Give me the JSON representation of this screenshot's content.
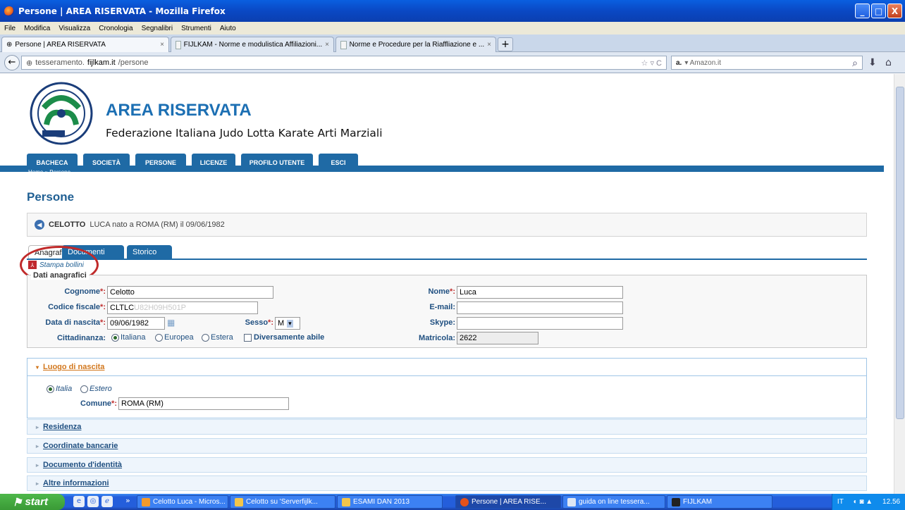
{
  "window": {
    "title": "Persone | AREA RISERVATA - Mozilla Firefox",
    "minimize": "_",
    "maximize": "□",
    "close": "X"
  },
  "menu": [
    "File",
    "Modifica",
    "Visualizza",
    "Cronologia",
    "Segnalibri",
    "Strumenti",
    "Aiuto"
  ],
  "tabs": [
    {
      "label": "Persone | AREA RISERVATA",
      "close": "×",
      "active": true
    },
    {
      "label": "FIJLKAM - Norme e modulistica Affiliazioni...",
      "close": "×"
    },
    {
      "label": "Norme e Procedure per la Riaffliazione e ...",
      "close": "×"
    }
  ],
  "newtab": "+",
  "nav": {
    "back": "←",
    "url_prefix": "tesseramento.",
    "url_host": "fijlkam.it",
    "url_path": "/persone",
    "star": "☆ ▿ C",
    "search_engine": "a.",
    "search_placeholder": "▾ Amazon.it",
    "search_icon": "⌕",
    "download_icon": "⬇",
    "home_icon": "⌂"
  },
  "site": {
    "title": "AREA RISERVATA",
    "subtitle": "Federazione Italiana Judo Lotta Karate Arti Marziali"
  },
  "main_nav": [
    "BACHECA",
    "SOCIETÀ",
    "PERSONE",
    "LICENZE",
    "PROFILO UTENTE",
    "ESCI"
  ],
  "breadcrumb": "Home » Persone",
  "page_title": "Persone",
  "person": {
    "icon": "◀",
    "surname": "CELOTTO",
    "rest": "LUCA nato a ROMA (RM) il 09/06/1982"
  },
  "person_tabs": [
    "Anagrafica",
    "Documenti",
    "Storico"
  ],
  "stampa": {
    "icon": "⅄",
    "label": "Stampa bollini"
  },
  "anagrafici": {
    "legend": "Dati anagrafici",
    "req_mark": "*:",
    "cognome_label": "Cognome",
    "cognome_value": "Celotto",
    "codice_label": "Codice fiscale",
    "codice_value": "CLTLC",
    "codice_ghost": "U82H09H501P",
    "nascita_label": "Data di nascita",
    "nascita_value": "09/06/1982",
    "cal_icon": "▦",
    "sesso_label": "Sesso",
    "sesso_value": "M",
    "sesso_arrow": "▾",
    "citt_label": "Cittadinanza:",
    "opt_italiana": "Italiana",
    "opt_europea": "Europea",
    "opt_estera": "Estera",
    "diversamente": "Diversamente abile",
    "nome_label": "Nome",
    "nome_value": "Luca",
    "email_label": "E-mail:",
    "email_value": "",
    "skype_label": "Skype:",
    "skype_value": "",
    "matricola_label": "Matricola:",
    "matricola_value": "2622"
  },
  "luogo": {
    "title": "Luogo di nascita",
    "arrow": "▾",
    "opt_italia": "Italia",
    "opt_estero": "Estero",
    "comune_label": "Comune",
    "comune_value": "ROMA (RM)"
  },
  "sections": [
    {
      "title": "Residenza",
      "arrow": "▸"
    },
    {
      "title": "Coordinate bancarie",
      "arrow": "▸"
    },
    {
      "title": "Documento d'identità",
      "arrow": "▸"
    },
    {
      "title": "Altre informazioni",
      "arrow": "▸"
    }
  ],
  "taskbar": {
    "start": "start",
    "items": [
      "Celotto Luca - Micros...",
      "Celotto su 'Serverfijlk...",
      "ESAMI DAN 2013",
      "Persone | AREA RISE...",
      "guida on line tessera...",
      "FIJLKAM"
    ],
    "ql": [
      "e",
      "◎",
      "ℯ"
    ],
    "more": "»",
    "tray": {
      "lang": "IT",
      "time": "12.56"
    }
  }
}
